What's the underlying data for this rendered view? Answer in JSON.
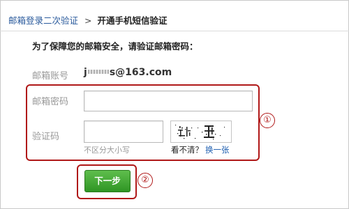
{
  "breadcrumb": {
    "step1": "邮箱登录二次验证",
    "separator": ">",
    "step2": "开通手机短信验证"
  },
  "instruction": "为了保障您的邮箱安全，请验证邮箱密码：",
  "form": {
    "account_label": "邮箱账号",
    "account_prefix": "j",
    "account_suffix": "s@163.com",
    "password_label": "邮箱密码",
    "password_value": "",
    "captcha_label": "验证码",
    "captcha_value": "",
    "captcha_hint": "不区分大小写",
    "refresh_question": "看不清？",
    "refresh_link": "换一张"
  },
  "annotations": {
    "marker1": "①",
    "marker2": "②",
    "color": "#b01818"
  },
  "next_button": {
    "label": "下一步",
    "color": "#3aa12c"
  }
}
